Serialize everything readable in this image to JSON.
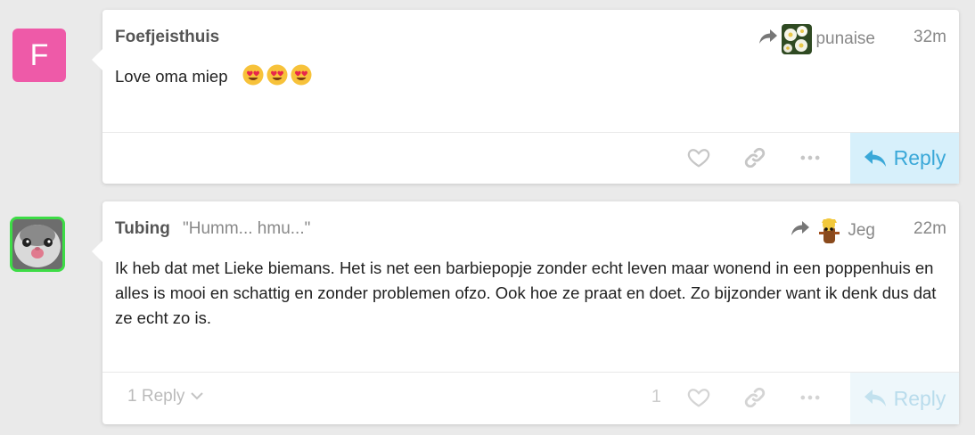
{
  "posts": [
    {
      "author": "Foefjeisthuis",
      "avatar_letter": "F",
      "reply_to_user": "punaise",
      "time": "32m",
      "body": "Love oma miep",
      "actions": {
        "reply_label": "Reply"
      }
    },
    {
      "author": "Tubing",
      "user_title": "\"Humm... hmu...\"",
      "reply_to_user": "Jeg",
      "time": "22m",
      "body": "Ik heb dat met Lieke biemans. Het is net een barbiepopje zonder echt leven maar wonend in een poppenhuis en alles is mooi en schattig en zonder problemen ofzo. Ook hoe ze praat en doet. Zo bijzonder want ik denk dus dat ze echt zo is.",
      "like_count": "1",
      "replies_label": "1 Reply",
      "actions": {
        "reply_label": "Reply"
      }
    }
  ],
  "colors": {
    "accent": "#3aa8d8",
    "avatar_f": "#ee5aa8",
    "avatar_ring": "#3ddc46"
  }
}
